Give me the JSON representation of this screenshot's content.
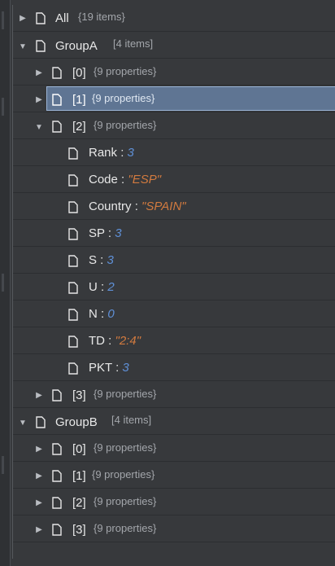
{
  "tree": {
    "all": {
      "label": "All",
      "meta": "{19 items}"
    },
    "groupA": {
      "label": "GroupA",
      "meta": "[4 items]",
      "items": [
        {
          "label": "[0]",
          "meta": "{9 properties}"
        },
        {
          "label": "[1]",
          "meta": "{9 properties}"
        },
        {
          "label": "[2]",
          "meta": "{9 properties}"
        },
        {
          "label": "[3]",
          "meta": "{9 properties}"
        }
      ],
      "expanded_item_props": [
        {
          "key": "Rank",
          "sep": " : ",
          "value": "3",
          "type": "num"
        },
        {
          "key": "Code",
          "sep": " : ",
          "value": "\"ESP\"",
          "type": "str"
        },
        {
          "key": "Country",
          "sep": " : ",
          "value": "\"SPAIN\"",
          "type": "str"
        },
        {
          "key": "SP",
          "sep": " : ",
          "value": "3",
          "type": "num"
        },
        {
          "key": "S",
          "sep": " : ",
          "value": "3",
          "type": "num"
        },
        {
          "key": "U",
          "sep": " : ",
          "value": "2",
          "type": "num"
        },
        {
          "key": "N",
          "sep": " : ",
          "value": "0",
          "type": "num"
        },
        {
          "key": "TD",
          "sep": " : ",
          "value": "\"2:4\"",
          "type": "str"
        },
        {
          "key": "PKT",
          "sep": " : ",
          "value": "3",
          "type": "num"
        }
      ]
    },
    "groupB": {
      "label": "GroupB",
      "meta": "[4 items]",
      "items": [
        {
          "label": "[0]",
          "meta": "{9 properties}"
        },
        {
          "label": "[1]",
          "meta": "{9 properties}"
        },
        {
          "label": "[2]",
          "meta": "{9 properties}"
        },
        {
          "label": "[3]",
          "meta": "{9 properties}"
        }
      ]
    }
  },
  "icons": {
    "expanded": "caret-down-icon",
    "collapsed": "caret-right-icon",
    "node": "document-icon"
  },
  "colors": {
    "background": "#37393c",
    "selection": "#5f7593",
    "number_value": "#5f90d7",
    "string_value": "#d17a3f",
    "meta_text": "#a3a6ab"
  }
}
